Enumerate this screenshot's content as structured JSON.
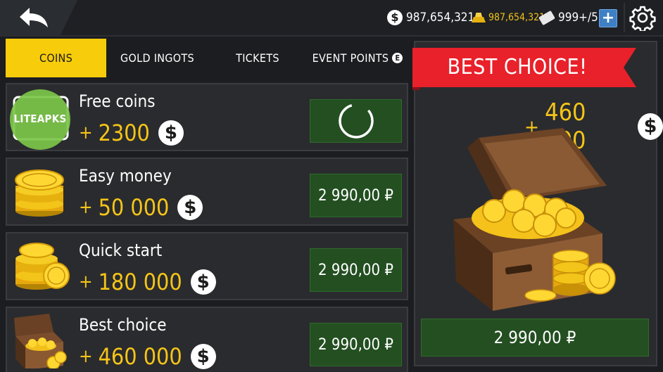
{
  "topbar": {
    "coins": "987,654,321",
    "gold": "987,654,321",
    "tickets": "999+/5",
    "plus_label": "+",
    "coin_symbol": "$"
  },
  "tabs": [
    {
      "label": "COINS",
      "active": true
    },
    {
      "label": "GOLD INGOTS",
      "active": false
    },
    {
      "label": "TICKETS",
      "active": false
    },
    {
      "label": "EVENT POINTS",
      "active": false,
      "badge": "E"
    }
  ],
  "offers": [
    {
      "title": "Free coins",
      "plus": "+",
      "amount": "2300",
      "button": "",
      "button_icon": "loading-spinner-icon"
    },
    {
      "title": "Easy money",
      "plus": "+",
      "amount": "50 000",
      "button": "2 990,00 ₽"
    },
    {
      "title": "Quick start",
      "plus": "+",
      "amount": "180 000",
      "button": "2 990,00 ₽"
    },
    {
      "title": "Best choice",
      "plus": "+",
      "amount": "460 000",
      "button": "2 990,00 ₽"
    }
  ],
  "best_choice": {
    "ribbon": "BEST CHOICE!",
    "plus": "+",
    "amount": "460 000",
    "button": "2 990,00 ₽"
  },
  "watermark": "LITEAPKS",
  "colors": {
    "accent_yellow": "#f7cc0b",
    "amount_gold": "#f5c518",
    "buy_green": "#234f21",
    "ribbon_red": "#e8212a",
    "panel_bg": "#2a2b2e"
  }
}
